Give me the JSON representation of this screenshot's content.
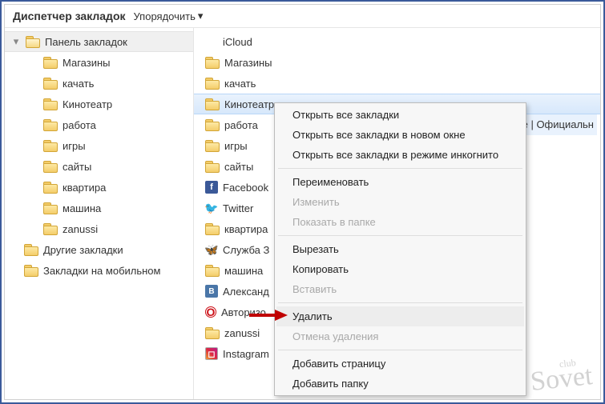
{
  "menubar": {
    "title": "Диспетчер закладок",
    "sort_label": "Упорядочить"
  },
  "tree": {
    "root": {
      "label": "Панель закладок"
    },
    "children": [
      {
        "label": "Магазины"
      },
      {
        "label": "качать"
      },
      {
        "label": "Кинотеатр"
      },
      {
        "label": "работа"
      },
      {
        "label": "игры"
      },
      {
        "label": "сайты"
      },
      {
        "label": "квартира"
      },
      {
        "label": "машина"
      },
      {
        "label": "zanussi"
      }
    ],
    "other": {
      "label": "Другие закладки"
    },
    "mobile": {
      "label": "Закладки на мобильном"
    }
  },
  "list": {
    "items": [
      {
        "label": "iCloud",
        "icon": "apple"
      },
      {
        "label": "Магазины",
        "icon": "folder"
      },
      {
        "label": "качать",
        "icon": "folder"
      },
      {
        "label": "Кинотеатр",
        "icon": "folder",
        "selected": true
      },
      {
        "label": "работа",
        "icon": "folder"
      },
      {
        "label": "игры",
        "icon": "folder"
      },
      {
        "label": "сайты",
        "icon": "folder"
      },
      {
        "label": "Facebook",
        "icon": "fb"
      },
      {
        "label": "Twitter",
        "icon": "tw"
      },
      {
        "label": "квартира",
        "icon": "folder"
      },
      {
        "label": "Служба З",
        "icon": "butterfly"
      },
      {
        "label": "машина",
        "icon": "folder"
      },
      {
        "label": "Александ",
        "icon": "vk"
      },
      {
        "label": "Авторизо",
        "icon": "opera"
      },
      {
        "label": "zanussi",
        "icon": "folder"
      },
      {
        "label": "Instagram",
        "icon": "ig"
      }
    ],
    "overflow_text": "ге | Официальн"
  },
  "context_menu": {
    "items": [
      {
        "label": "Открыть все закладки",
        "enabled": true
      },
      {
        "label": "Открыть все закладки в новом окне",
        "enabled": true
      },
      {
        "label": "Открыть все закладки в режиме инкогнито",
        "enabled": true
      },
      {
        "sep": true
      },
      {
        "label": "Переименовать",
        "enabled": true
      },
      {
        "label": "Изменить",
        "enabled": false
      },
      {
        "label": "Показать в папке",
        "enabled": false
      },
      {
        "sep": true
      },
      {
        "label": "Вырезать",
        "enabled": true
      },
      {
        "label": "Копировать",
        "enabled": true
      },
      {
        "label": "Вставить",
        "enabled": false
      },
      {
        "sep": true
      },
      {
        "label": "Удалить",
        "enabled": true,
        "hover": true
      },
      {
        "label": "Отмена удаления",
        "enabled": false
      },
      {
        "sep": true
      },
      {
        "label": "Добавить страницу",
        "enabled": true
      },
      {
        "label": "Добавить папку",
        "enabled": true
      }
    ]
  },
  "watermark": {
    "line1": "club",
    "line2": "Sovet"
  }
}
